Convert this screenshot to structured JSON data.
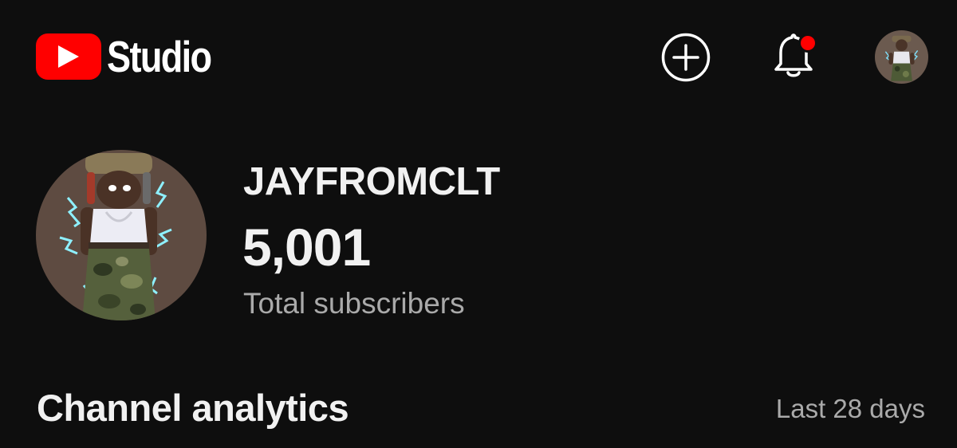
{
  "header": {
    "app_name": "Studio",
    "logo_icon": "youtube-play-icon",
    "create_icon": "plus-circle-icon",
    "notifications_icon": "bell-icon",
    "account_icon": "account-avatar"
  },
  "channel": {
    "name": "JAYFROMCLT",
    "subscriber_count": "5,001",
    "subscriber_label": "Total subscribers"
  },
  "analytics": {
    "title": "Channel analytics",
    "period": "Last 28 days"
  },
  "colors": {
    "background": "#0e0e0e",
    "brand_red": "#ff0000",
    "text_primary": "#f1f1f1",
    "text_secondary": "#aaaaaa",
    "notification_dot": "#ff0000"
  }
}
